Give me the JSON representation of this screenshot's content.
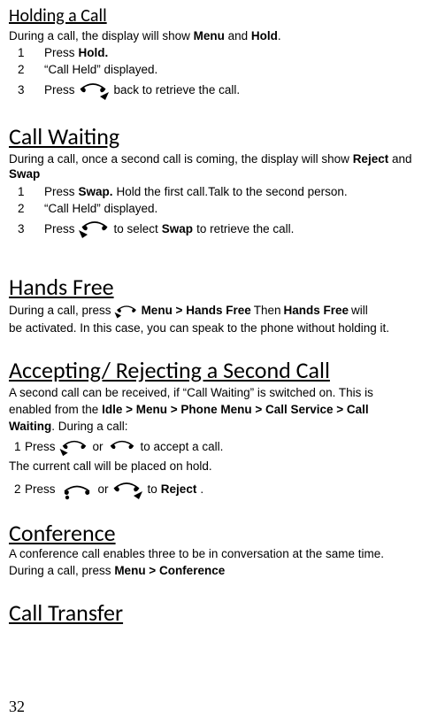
{
  "page_number": "32",
  "sections": {
    "holding": {
      "title": "Holding a Call",
      "intro_pre": "During a call, the display will show ",
      "intro_b1": "Menu",
      "intro_mid": " and ",
      "intro_b2": "Hold",
      "intro_post": ".",
      "step1_num": "1",
      "step1_pre": "Press ",
      "step1_b": "Hold.",
      "step2_num": "2",
      "step2_text": "“Call Held” displayed.",
      "step3_num": "3",
      "step3_pre": "Press  ",
      "step3_post": "  back to retrieve the call."
    },
    "call_waiting": {
      "title": "Call Waiting",
      "intro_pre": "During a call, once a second call is coming, the display will show ",
      "intro_b1": "Reject",
      "intro_mid": " and ",
      "intro_b2": "Swap",
      "step1_num": "1",
      "step1_pre": "Press ",
      "step1_b": "Swap.",
      "step1_post": " Hold the first call.Talk to the second person.",
      "step2_num": "2",
      "step2_text": "“Call Held” displayed.",
      "step3_num": "3",
      "step3_pre": "Press  ",
      "step3_mid": " to select ",
      "step3_b": "Swap",
      "step3_post": " to retrieve the call."
    },
    "hands_free": {
      "title": "Hands Free",
      "line_pre": "During a call, press ",
      "line_b1": "Menu > Hands Free",
      "line_mid": " Then ",
      "line_b2": "Hands Free",
      "line_post1": " will",
      "line_post2": "be activated.  In this case, you can speak to the phone without holding it."
    },
    "accept_reject": {
      "title": "Accepting/ Rejecting a Second Call",
      "intro_l1_pre": "A second call can be received, if “Call Waiting” is switched on. This is",
      "intro_l2_pre": "enabled from the ",
      "intro_l2_b": "Idle > Menu > Phone Menu > Call Service > Call",
      "intro_l3_b": "Waiting",
      "intro_l3_post": ".  During a call:",
      "s1_num": "1",
      "s1_pre": "Press   ",
      "s1_or": "or   ",
      "s1_post": "  to accept a call.",
      "hold_note": "The current call will be placed on hold.",
      "s2_num": "2",
      "s2_pre": "Press  ",
      "s2_mid": "     or ",
      "s2_post": "  to ",
      "s2_b": "Reject",
      "s2_end": "."
    },
    "conference": {
      "title": "Conference",
      "line1": "A conference call enables three to be in conversation at the same time.",
      "line2_pre": "During a call, press ",
      "line2_b": "Menu > Conference"
    },
    "call_transfer": {
      "title": "Call Transfer"
    }
  }
}
